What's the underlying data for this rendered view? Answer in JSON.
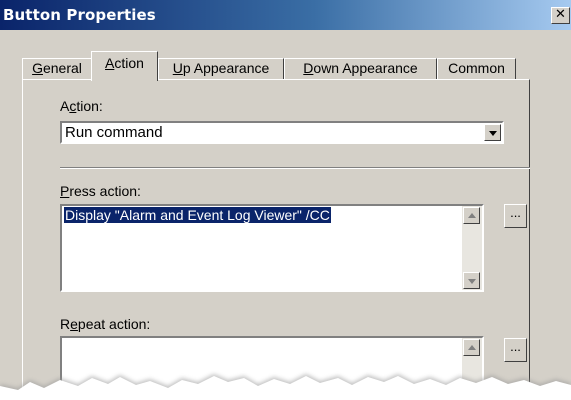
{
  "window": {
    "title": "Button Properties",
    "close_glyph": "✕"
  },
  "tabs": [
    {
      "label": "General",
      "underline_index": 0,
      "active": false
    },
    {
      "label": "Action",
      "underline_index": 0,
      "active": true
    },
    {
      "label": "Up Appearance",
      "underline_index": 0,
      "active": false
    },
    {
      "label": "Down Appearance",
      "underline_index": 0,
      "active": false
    },
    {
      "label": "Common",
      "underline_index": -1,
      "active": false
    }
  ],
  "action": {
    "label": "Action:",
    "mnemonic_index": 1,
    "selected": "Run command"
  },
  "press_action": {
    "label": "Press action:",
    "mnemonic_index": 0,
    "value": "Display \"Alarm and Event Log Viewer\" /CC",
    "browse_label": "..."
  },
  "repeat_action": {
    "label": "Repeat action:",
    "mnemonic_index": 1,
    "value": "",
    "browse_label": "..."
  },
  "colors": {
    "titlebar_start": "#0a246a",
    "titlebar_end": "#a6caf0",
    "dialog_face": "#d4d0c8",
    "selection": "#0a246a"
  }
}
